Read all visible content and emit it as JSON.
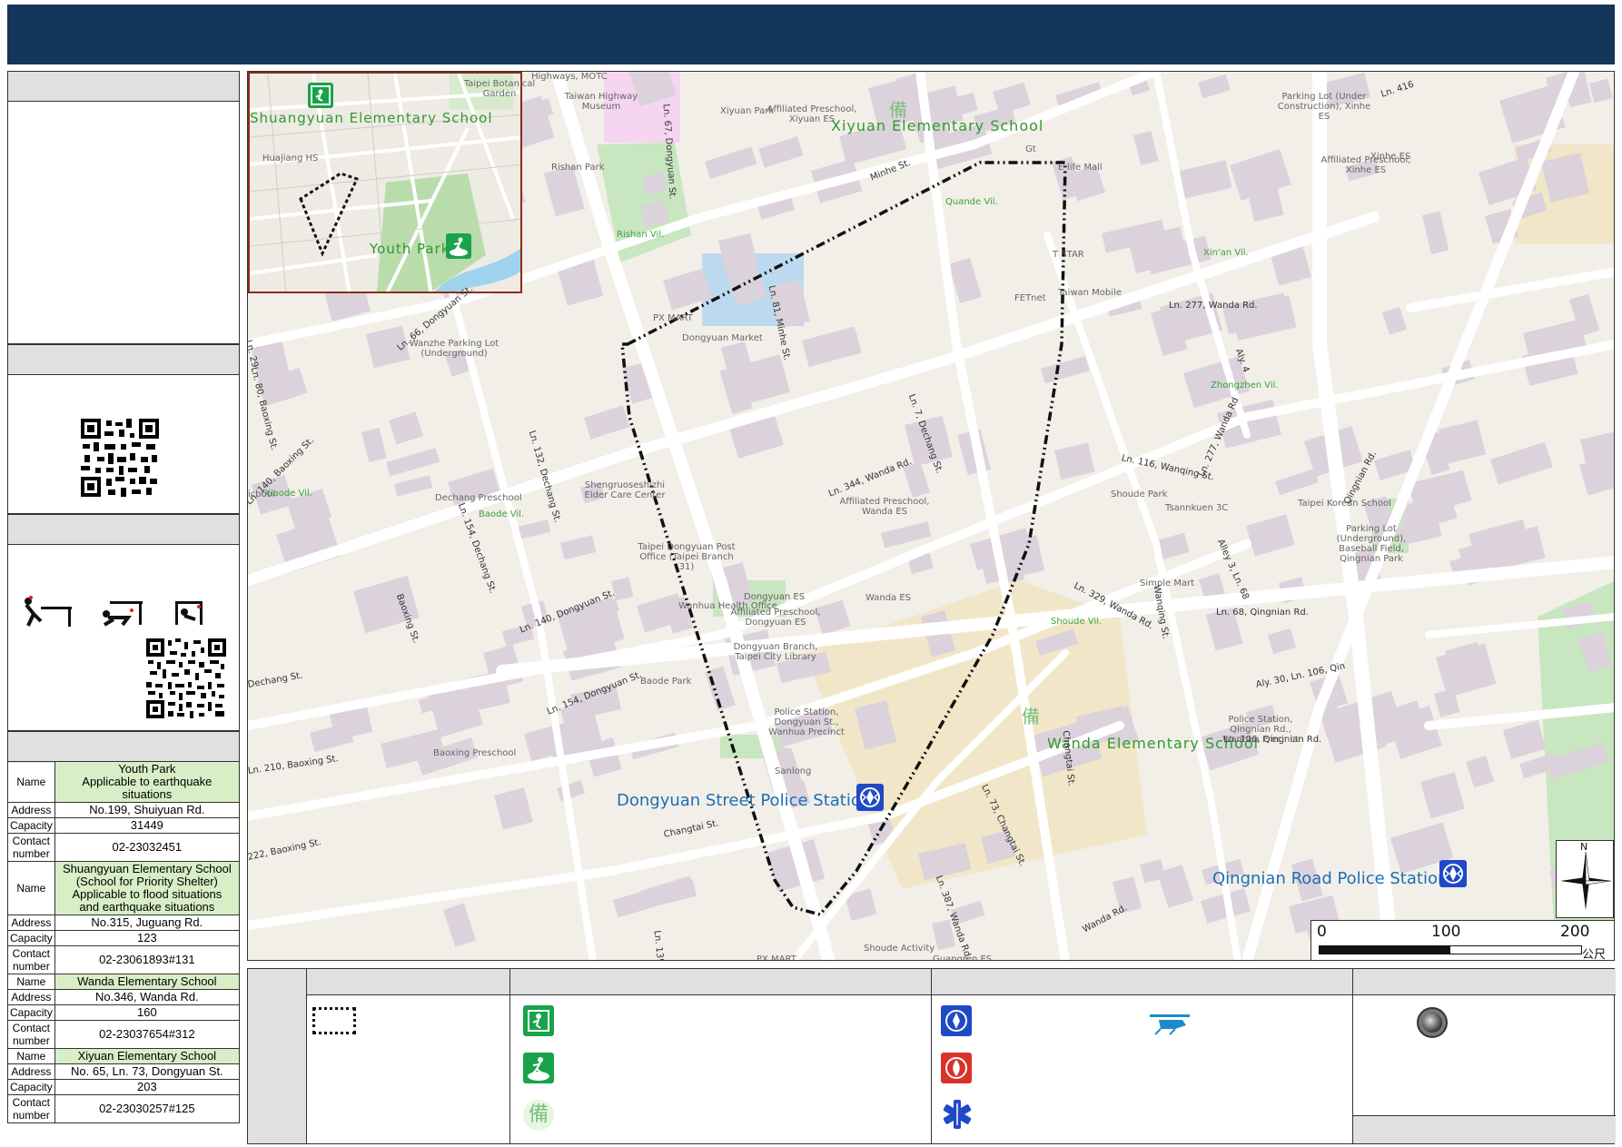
{
  "map": {
    "points": [
      {
        "name": "Shuangyuan Elementary School",
        "type": "evacuation-shelter"
      },
      {
        "name": "Youth Park",
        "type": "evacuation-open-space"
      },
      {
        "name": "Xiyuan Elementary School",
        "type": "backup-shelter"
      },
      {
        "name": "Wanda Elementary School",
        "type": "backup-shelter"
      },
      {
        "name": "Dongyuan Street Police Station",
        "type": "police"
      },
      {
        "name": "Qingnian Road Police Station",
        "type": "police"
      }
    ],
    "inset_labels": {
      "shuangyuan": "Shuangyuan Elementary School",
      "youth_park": "Youth Park"
    },
    "labels": {
      "xiyuan": "Xiyuan Elementary School",
      "wanda": "Wanda Elementary School",
      "dongyuan_police": "Dongyuan Street Police Station",
      "qingnian_police": "Qingnian Road Police Station"
    },
    "streets": [
      {
        "text": "Minhe St."
      },
      {
        "text": "Ln. 81, Minhe St."
      },
      {
        "text": "Ln. 344, Wanda Rd."
      },
      {
        "text": "Ln. 140, Dongyuan St."
      },
      {
        "text": "Ln. 154, Dongyuan St."
      },
      {
        "text": "Ln. 210, Baoxing St."
      },
      {
        "text": "Changtai St."
      },
      {
        "text": "Ln. 139, Changtai St."
      },
      {
        "text": "Ln. 387, Wanda Rd."
      },
      {
        "text": "Ln. 73, Changtai St."
      },
      {
        "text": "Ln. 277, Wanda Rd."
      },
      {
        "text": "Ln. 116, Wanqing St."
      },
      {
        "text": "Ln. 329, Wanda Rd."
      },
      {
        "text": "Ln. 68, Qingnian Rd."
      },
      {
        "text": "Ln. 106, Qingnian Rd."
      },
      {
        "text": "Ln. 7, Dechang St."
      },
      {
        "text": "Ln. 132, Dechang St."
      },
      {
        "text": "Ln. 154, Dechang St."
      },
      {
        "text": "Baoxing St."
      },
      {
        "text": "Ln. 140, Baoxing St."
      },
      {
        "text": "222, Baoxing St."
      },
      {
        "text": "Wanqing St."
      },
      {
        "text": "Ln. 66, Dongyuan St."
      },
      {
        "text": "Ln. 80, Baoxing St."
      },
      {
        "text": "Ln. 29"
      },
      {
        "text": "Ln. 67, Dongyuan St."
      },
      {
        "text": "Dechang St."
      },
      {
        "text": "Changtai St."
      },
      {
        "text": "Qingnian Rd."
      },
      {
        "text": "Alley 3, Ln. 68"
      },
      {
        "text": "Ln. 416"
      },
      {
        "text": "Wanda Rd."
      },
      {
        "text": "Aly. 30, Ln. 106, Qin"
      },
      {
        "text": "Ln. 277, Wanda Rd"
      },
      {
        "text": "Aly. 4"
      }
    ],
    "villages": [
      {
        "text": "Rishan Vil."
      },
      {
        "text": "Quande Vil."
      },
      {
        "text": "Xin'an Vil."
      },
      {
        "text": "Zhongzhen Vil."
      },
      {
        "text": "Xiaode Vil."
      },
      {
        "text": "Baode Vil."
      },
      {
        "text": "Shoude Vil."
      }
    ],
    "pois": [
      {
        "text": "Taipei Botanical Garden"
      },
      {
        "text": "Huajiang HS"
      },
      {
        "text": "Highways, MOTC"
      },
      {
        "text": "Taiwan Highway Museum"
      },
      {
        "text": "Rishan Park"
      },
      {
        "text": "Xiyuan Park"
      },
      {
        "text": "Affiliated Preschool, Xiyuan ES"
      },
      {
        "text": "Gt"
      },
      {
        "text": "E-life Mall"
      },
      {
        "text": "Parking Lot (Under Construction), Xinhe ES"
      },
      {
        "text": "Affiliated Preschool, Xinhe ES"
      },
      {
        "text": "Xinhe ES"
      },
      {
        "text": "PX MART"
      },
      {
        "text": "Dongyuan Market"
      },
      {
        "text": "Wanzhe Parking Lot (Underground)"
      },
      {
        "text": "T STAR"
      },
      {
        "text": "Taiwan Mobile"
      },
      {
        "text": "FETnet"
      },
      {
        "text": "Shoude Park"
      },
      {
        "text": "Dechang Preschool"
      },
      {
        "text": "Shengruoseshizhi Elder Care Center"
      },
      {
        "text": "Tsannkuen 3C"
      },
      {
        "text": "Affiliated Preschool, Wanda ES"
      },
      {
        "text": "Taipei Korean School"
      },
      {
        "text": "Parking Lot (Underground), Baseball Field, Qingnian Park"
      },
      {
        "text": "Taipei Dongyuan Post Office (Taipei Branch 31)"
      },
      {
        "text": "Dongyuan ES"
      },
      {
        "text": "Wanhua Health Office"
      },
      {
        "text": "Affiliated Preschool, Dongyuan ES"
      },
      {
        "text": "Dongyuan Branch, Taipei City Library"
      },
      {
        "text": "Wanda ES"
      },
      {
        "text": "Simple Mart"
      },
      {
        "text": "Baode Park"
      },
      {
        "text": "Baseball Field, Qingnian"
      },
      {
        "text": "Police Station, Dongyuan St., Wanhua Precinct"
      },
      {
        "text": "Police Station, Qingnian Rd., Wanhua Precinct"
      },
      {
        "text": "Baoxing Preschool"
      },
      {
        "text": "Sanlong"
      },
      {
        "text": "Shoude Activity"
      },
      {
        "text": "PX MART"
      },
      {
        "text": "Guangren ES"
      },
      {
        "text": "ichool"
      }
    ],
    "scale": {
      "t0": "0",
      "t1": "100",
      "t2": "200",
      "unit": "公尺"
    },
    "north": "N"
  },
  "info_table": [
    {
      "label": "Name",
      "value": "Youth Park\nApplicable to earthquake situations",
      "green": true
    },
    {
      "label": "Address",
      "value": "No.199, Shuiyuan Rd."
    },
    {
      "label": "Capacity",
      "value": "31449"
    },
    {
      "label": "Contact number",
      "value": "02-23032451"
    },
    {
      "label": "Name",
      "value": "Shuangyuan Elementary School\n(School for Priority Shelter)\nApplicable to flood situations\nand earthquake situations",
      "green": true
    },
    {
      "label": "Address",
      "value": "No.315, Juguang Rd."
    },
    {
      "label": "Capacity",
      "value": "123"
    },
    {
      "label": "Contact number",
      "value": "02-23061893#131"
    },
    {
      "label": "Name",
      "value": "Wanda Elementary School",
      "green": true
    },
    {
      "label": "Address",
      "value": "No.346, Wanda Rd."
    },
    {
      "label": "Capacity",
      "value": "160"
    },
    {
      "label": "Contact number",
      "value": "02-23037654#312"
    },
    {
      "label": "Name",
      "value": "Xiyuan Elementary School",
      "green": true
    },
    {
      "label": "Address",
      "value": "No. 65, Ln. 73, Dongyuan St."
    },
    {
      "label": "Capacity",
      "value": "203"
    },
    {
      "label": "Contact number",
      "value": "02-23030257#125"
    }
  ],
  "legend": {
    "col4_symbol": "備"
  },
  "colors": {
    "title_bar": "#14365a",
    "panel_head": "#e0e0e0",
    "green_label": "#2f9a2f",
    "police_blue": "#1c6fb5",
    "route": "#111111"
  }
}
